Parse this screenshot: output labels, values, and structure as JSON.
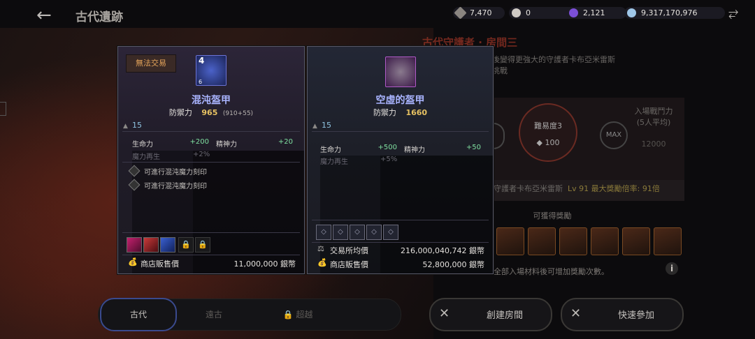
{
  "header": {
    "title": "古代遺跡",
    "currencies": [
      {
        "value": "7,470",
        "color": "#8a8580"
      },
      {
        "value": "0",
        "color": "#cfcac4"
      },
      {
        "value": "2,121",
        "color": "#7b4fd6"
      },
      {
        "value": "9,317,170,976",
        "color": "#9fc7e8"
      }
    ]
  },
  "room": {
    "title": "古代守護者 · 房間三",
    "desc_line1": "後變得更強大的守護者卡布亞米雷斯",
    "desc_line2": "挑戰",
    "difficulty_label": "難易度3",
    "difficulty_value": "100",
    "max_label": "MAX",
    "entry_label_1": "入場戰鬥力",
    "entry_label_2": "(5人平均)",
    "entry_value": "12000",
    "boss_name": "守護者卡布亞米雷斯",
    "boss_level": "Lv 91 最大獎勵倍率: 91倍",
    "reward_label": "可獲得獎勵",
    "footer_note": "全部入場材料後可增加獎勵次數。",
    "info_icon": "i"
  },
  "tabs": [
    {
      "label": "古代"
    },
    {
      "label": "遠古"
    },
    {
      "label": "超越"
    }
  ],
  "buttons": {
    "create_room": "創建房間",
    "quick_join": "快速參加"
  },
  "tooltip_left": {
    "trade_badge": "無法交易",
    "icon_level": "4",
    "icon_sub": "6",
    "name": "混沌盔甲",
    "defense_label": "防禦力",
    "defense_value": "965",
    "defense_extra": "(910+55)",
    "level_req": "15",
    "stats": [
      {
        "label": "生命力",
        "value": "+200"
      },
      {
        "label": "精神力",
        "value": "+20"
      },
      {
        "label": "魔力再生",
        "value": "+2%"
      }
    ],
    "runes": [
      "可進行混沌魔力刻印",
      "可進行混沌魔力刻印"
    ],
    "shop_label": "商店販售價",
    "shop_value": "11,000,000 銀幣"
  },
  "tooltip_right": {
    "name": "空虛的盔甲",
    "defense_label": "防禦力",
    "defense_value": "1660",
    "level_req": "15",
    "stats": [
      {
        "label": "生命力",
        "value": "+500"
      },
      {
        "label": "精神力",
        "value": "+50"
      },
      {
        "label": "魔力再生",
        "value": "+5%"
      }
    ],
    "avg_label": "交易所均價",
    "avg_value": "216,000,040,742 銀幣",
    "shop_label": "商店販售價",
    "shop_value": "52,800,000 銀幣"
  }
}
